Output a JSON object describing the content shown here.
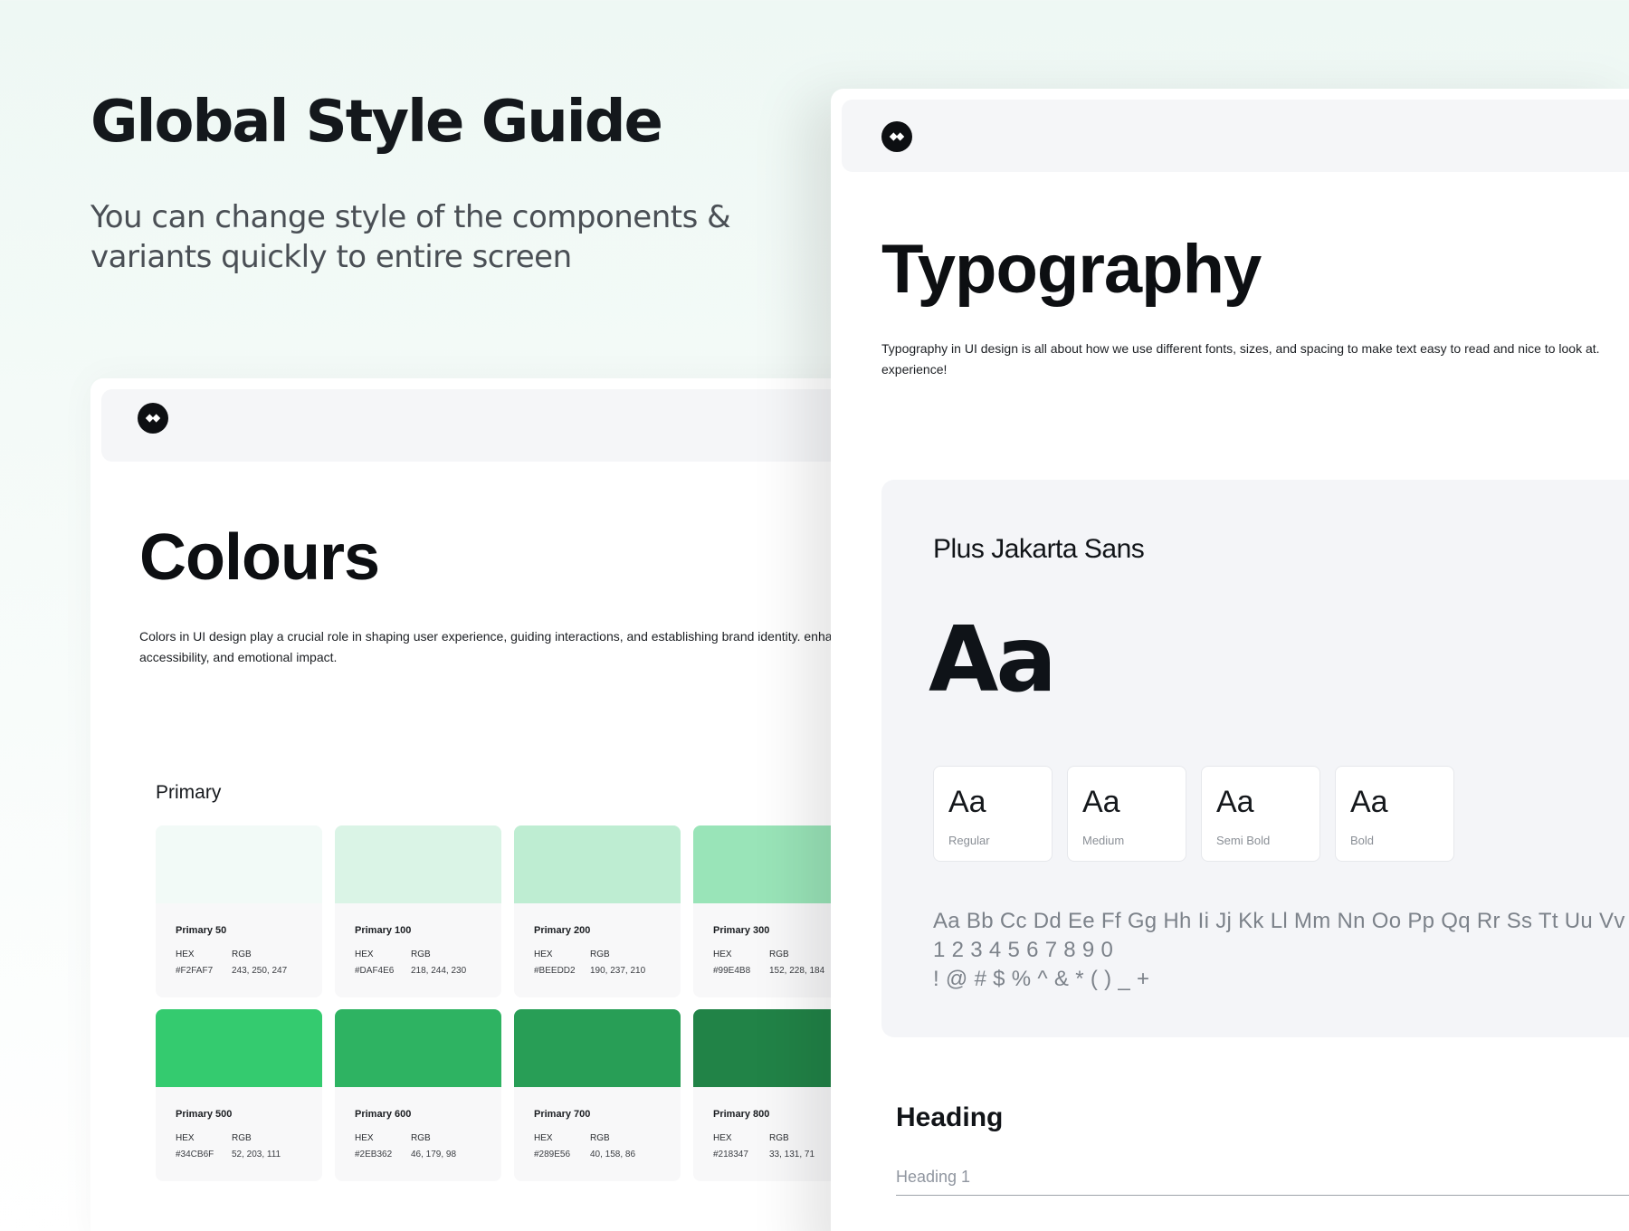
{
  "hero": {
    "title": "Global Style Guide",
    "subtitle": "You can change style of the components & variants quickly to entire screen"
  },
  "colours": {
    "title": "Colours",
    "description": "Colors in UI design play a crucial role in shaping user experience, guiding interactions, and establishing brand identity. enhances readability, accessibility, and emotional impact.",
    "primary_label": "Primary",
    "hex_label": "HEX",
    "rgb_label": "RGB",
    "swatches": [
      {
        "name": "Primary 50",
        "hex": "#F2FAF7",
        "rgb": "243, 250, 247",
        "color": "#F2FAF7"
      },
      {
        "name": "Primary 100",
        "hex": "#DAF4E6",
        "rgb": "218, 244, 230",
        "color": "#DAF4E6"
      },
      {
        "name": "Primary 200",
        "hex": "#BEEDD2",
        "rgb": "190, 237, 210",
        "color": "#BEEDD2"
      },
      {
        "name": "Primary 300",
        "hex": "#99E4B8",
        "rgb": "152, 228, 184",
        "color": "#99E4B8"
      },
      {
        "name": "Primary 500",
        "hex": "#34CB6F",
        "rgb": "52, 203, 111",
        "color": "#34CB6F"
      },
      {
        "name": "Primary 600",
        "hex": "#2EB362",
        "rgb": "46, 179, 98",
        "color": "#2EB362"
      },
      {
        "name": "Primary 700",
        "hex": "#289E56",
        "rgb": "40, 158, 86",
        "color": "#289E56"
      },
      {
        "name": "Primary 800",
        "hex": "#218347",
        "rgb": "33, 131, 71",
        "color": "#218347"
      }
    ]
  },
  "typography": {
    "title": "Typography",
    "description": "Typography in UI design is all about how we use different fonts, sizes, and spacing to make text easy to read and nice to look at. experience!",
    "font_name": "Plus Jakarta Sans",
    "big_sample": "Aa",
    "weights": [
      {
        "sample": "Aa",
        "label": "Regular"
      },
      {
        "sample": "Aa",
        "label": "Medium"
      },
      {
        "sample": "Aa",
        "label": "Semi Bold"
      },
      {
        "sample": "Aa",
        "label": "Bold"
      }
    ],
    "alphabet": "Aa Bb Cc Dd Ee Ff Gg Hh Ii Jj Kk Ll Mm Nn Oo Pp Qq Rr Ss Tt Uu Vv Ww",
    "digits": "1 2 3 4 5 6 7 8 9 0",
    "symbols": "! @ # $ % ^ & * ( ) _ +",
    "heading_title": "Heading",
    "heading_sub": "Heading 1"
  },
  "logo_icon": "brand-logo-icon"
}
